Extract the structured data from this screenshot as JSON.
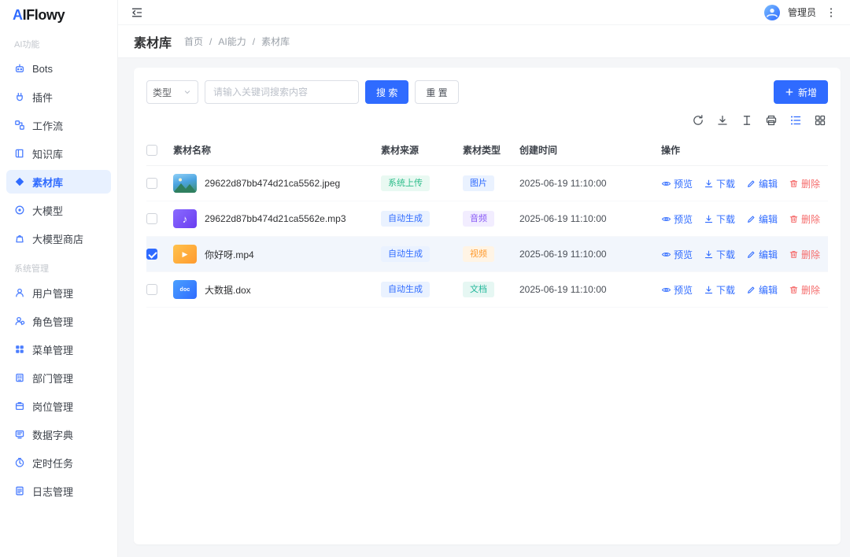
{
  "brand": {
    "name": "AIFlowy",
    "accent_color": "#2f6bff"
  },
  "topbar": {
    "user_name": "管理员"
  },
  "breadcrumb": {
    "page_title": "素材库",
    "separator": "/",
    "items": [
      "首页",
      "AI能力",
      "素材库"
    ]
  },
  "sidebar": {
    "active_item": "素材库",
    "sections": [
      {
        "label": "AI功能",
        "items": [
          {
            "label": "Bots",
            "icon": "bots-icon"
          },
          {
            "label": "插件",
            "icon": "plugin-icon"
          },
          {
            "label": "工作流",
            "icon": "workflow-icon"
          },
          {
            "label": "知识库",
            "icon": "knowledge-base-icon"
          },
          {
            "label": "素材库",
            "icon": "material-library-icon"
          },
          {
            "label": "大模型",
            "icon": "large-model-icon"
          },
          {
            "label": "大模型商店",
            "icon": "model-store-icon"
          }
        ]
      },
      {
        "label": "系统管理",
        "items": [
          {
            "label": "用户管理",
            "icon": "user-management-icon"
          },
          {
            "label": "角色管理",
            "icon": "role-management-icon"
          },
          {
            "label": "菜单管理",
            "icon": "menu-management-icon"
          },
          {
            "label": "部门管理",
            "icon": "department-management-icon"
          },
          {
            "label": "岗位管理",
            "icon": "position-management-icon"
          },
          {
            "label": "数据字典",
            "icon": "data-dictionary-icon"
          },
          {
            "label": "定时任务",
            "icon": "scheduled-task-icon"
          },
          {
            "label": "日志管理",
            "icon": "log-management-icon"
          }
        ]
      }
    ]
  },
  "filters": {
    "type_select_value": "类型",
    "keyword_placeholder": "请输入关键词搜索内容",
    "search_label": "搜 索",
    "reset_label": "重 置",
    "add_label": "新增"
  },
  "toolbar": {
    "icons": [
      "refresh-icon",
      "download-icon",
      "text-height-icon",
      "printer-icon",
      "list-view-icon",
      "grid-view-icon"
    ],
    "active_view": "list"
  },
  "table": {
    "select_all": false,
    "headers": {
      "name": "素材名称",
      "source": "素材来源",
      "type": "素材类型",
      "created": "创建时间",
      "actions": "操作"
    },
    "action_labels": {
      "preview": "预览",
      "download": "下载",
      "edit": "编辑",
      "delete": "删除"
    },
    "rows": [
      {
        "name": "29622d87bb474d21ca5562.jpeg",
        "thumb": "image-thumbnail",
        "source": "系统上传",
        "type": "图片",
        "created": "2025-06-19 11:10:00",
        "checked": false
      },
      {
        "name": "29622d87bb474d21ca5562e.mp3",
        "thumb": "audio-thumbnail",
        "source": "自动生成",
        "type": "音频",
        "created": "2025-06-19 11:10:00",
        "checked": false
      },
      {
        "name": "你好呀.mp4",
        "thumb": "video-thumbnail",
        "source": "自动生成",
        "type": "视频",
        "created": "2025-06-19 11:10:00",
        "checked": true
      },
      {
        "name": "大数据.dox",
        "thumb": "doc-thumbnail",
        "thumb_label": "doc",
        "source": "自动生成",
        "type": "文档",
        "created": "2025-06-19 11:10:00",
        "checked": false
      }
    ]
  },
  "glyphs": {
    "music_note": "♪",
    "play": "▶"
  },
  "colors": {
    "primary": "#2f6bff",
    "danger": "#f56c6c",
    "sidebar_active_bg": "#e8f1ff",
    "tag_green": "#2dbd8a",
    "tag_blue": "#2f6bff",
    "tag_purple": "#8a5cf6",
    "tag_orange": "#ff9a2e",
    "tag_teal": "#22b79a",
    "selected_row_bg": "#f2f6fc"
  }
}
